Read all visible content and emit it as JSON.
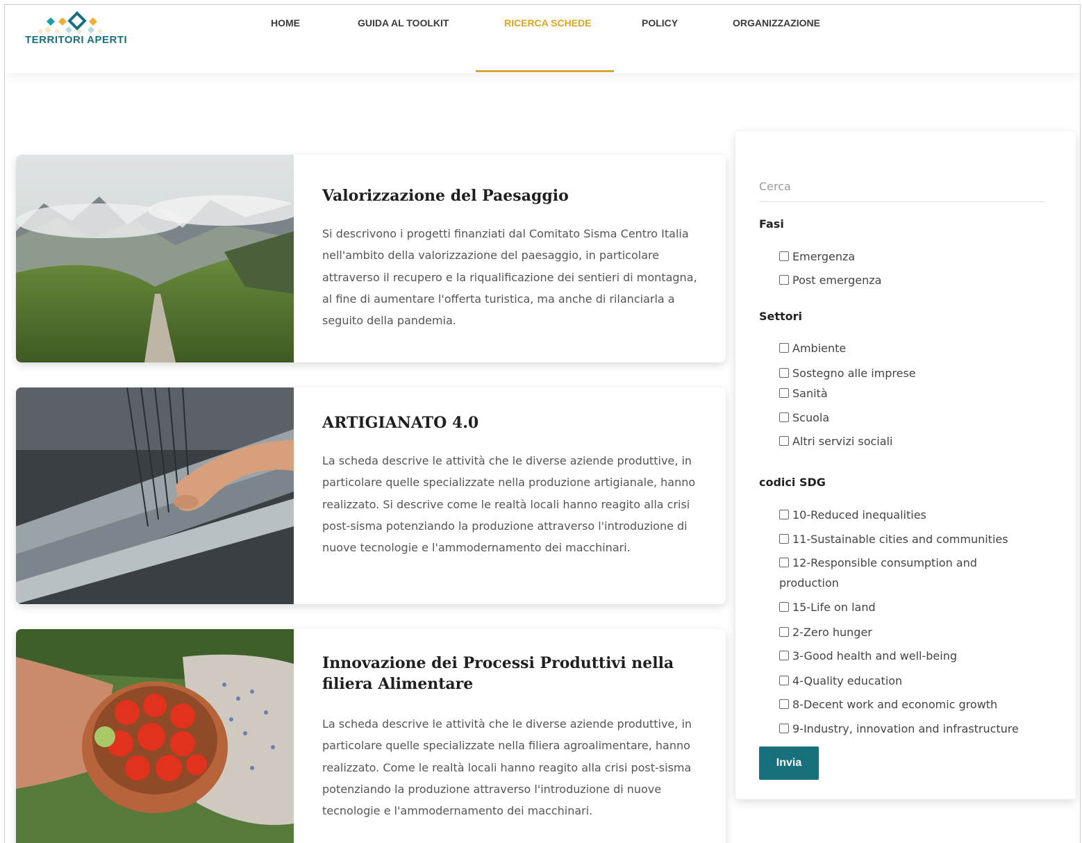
{
  "brand": {
    "name": "TERRITORI APERTI",
    "colors": {
      "teal": "#16707d",
      "gold": "#e0a41c"
    }
  },
  "nav": {
    "items": [
      {
        "label": "HOME"
      },
      {
        "label": "GUIDA AL TOOLKIT"
      },
      {
        "label": "RICERCA SCHEDE",
        "active": true
      },
      {
        "label": "POLICY"
      },
      {
        "label": "ORGANIZZAZIONE"
      }
    ]
  },
  "cards": [
    {
      "title": "Valorizzazione del Paesaggio",
      "text": "Si descrivono i progetti finanziati dal Comitato Sisma Centro Italia nell'ambito della valorizzazione del paesaggio, in particolare attraverso il recupero e la riqualificazione dei sentieri di montagna, al fine di aumentare l'offerta turistica, ma anche di rilanciarla a seguito della pandemia."
    },
    {
      "title": "ARTIGIANATO 4.0",
      "text": "La scheda descrive le attività che le diverse aziende produttive, in particolare quelle specializzate nella produzione artigianale, hanno realizzato. Si descrive come le realtà locali hanno reagito alla crisi post-sisma potenziando la produzione attraverso l'introduzione di nuove tecnologie e l'ammodernamento dei macchinari."
    },
    {
      "title": "Innovazione dei Processi Produttivi nella filiera Alimentare",
      "text": "La scheda descrive le attività che le diverse aziende produttive, in particolare quelle specializzate nella filiera agroalimentare, hanno realizzato. Come le realtà locali hanno reagito alla crisi post-sisma potenziando la produzione attraverso l'introduzione di nuove tecnologie e l'ammodernamento dei macchinari."
    }
  ],
  "filters": {
    "search_placeholder": "Cerca",
    "groups": [
      {
        "title": "Fasi",
        "options": [
          "Emergenza",
          "Post emergenza"
        ]
      },
      {
        "title": "Settori",
        "options": [
          "Ambiente",
          "Sostegno alle imprese",
          "Sanità",
          "Scuola",
          "Altri servizi sociali"
        ]
      },
      {
        "title": "codici SDG",
        "options": [
          "10-Reduced inequalities",
          "11-Sustainable cities and communities",
          "12-Responsible consumption and production",
          "15-Life on land",
          "2-Zero hunger",
          "3-Good health and well-being",
          "4-Quality education",
          "8-Decent work and economic growth",
          "9-Industry, innovation and infrastructure"
        ]
      }
    ],
    "submit_label": "Invia"
  }
}
